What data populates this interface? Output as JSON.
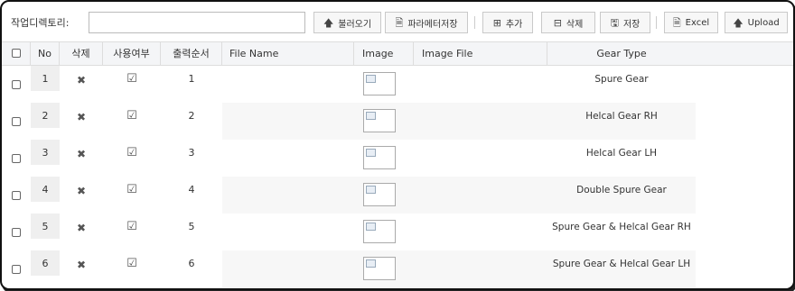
{
  "toolbar": {
    "dir_label": "작업디렉토리:",
    "dir_value": "",
    "buttons": {
      "load": "불러오기",
      "param_save": "파라메터저장",
      "add": "추가",
      "delete": "삭제",
      "save": "저장",
      "excel": "Excel",
      "upload": "Upload"
    }
  },
  "table": {
    "headers": {
      "no": "No",
      "delete": "삭제",
      "use": "사용여부",
      "order": "출력순서",
      "file_name": "File Name",
      "image": "Image",
      "image_file": "Image File",
      "gear_type": "Gear Type"
    },
    "rows": [
      {
        "no": "1",
        "order": "1",
        "gear_type": "Spure Gear"
      },
      {
        "no": "2",
        "order": "2",
        "gear_type": "Helcal Gear RH"
      },
      {
        "no": "3",
        "order": "3",
        "gear_type": "Helcal Gear LH"
      },
      {
        "no": "4",
        "order": "4",
        "gear_type": "Double Spure Gear"
      },
      {
        "no": "5",
        "order": "5",
        "gear_type": "Spure Gear & Helcal Gear RH"
      },
      {
        "no": "6",
        "order": "6",
        "gear_type": "Spure Gear & Helcal Gear LH"
      }
    ]
  },
  "icons": {
    "load": "arrow-up-icon",
    "param_save": "excel-file-icon",
    "add": "plus-square-icon",
    "delete": "minus-square-icon",
    "save": "floppy-icon",
    "excel": "excel-file-icon",
    "upload": "arrow-up-icon",
    "row_delete": "x-icon",
    "row_use": "checkbox-checked-icon"
  }
}
